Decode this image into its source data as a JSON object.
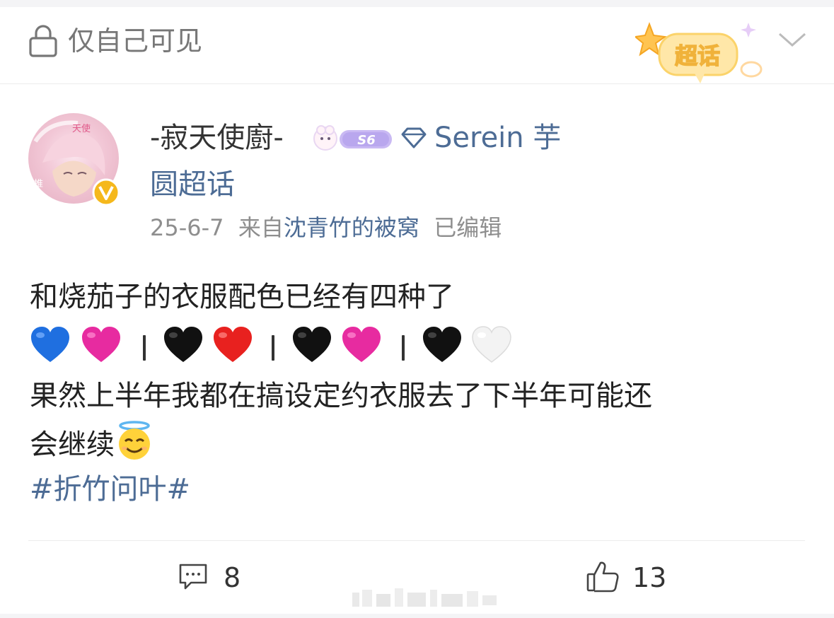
{
  "header": {
    "visibility_label": "仅自己可见",
    "supertopic_badge_label": "超话"
  },
  "post": {
    "author": {
      "username": "-寂天使廚-",
      "level_badge": "S6",
      "fan_title_part1": "Serein 芋",
      "fan_title_part2": "圆超话",
      "avatar_text": [
        "天使",
        "推"
      ]
    },
    "meta": {
      "date": "25-6-7",
      "source_prefix": "来自",
      "source_name": "沈青竹的被窝",
      "edited": "已编辑"
    },
    "content": {
      "line1": "和烧茄子的衣服配色已经有四种了",
      "hearts": [
        "blue-heart",
        "pink-heart",
        "separator",
        "black-heart",
        "red-heart",
        "separator",
        "black-heart",
        "pink-heart",
        "separator",
        "black-heart",
        "white-heart"
      ],
      "line3": "果然上半年我都在搞设定约衣服去了下半年可能还",
      "line4": "会继续",
      "hashtag": "#折竹问叶#"
    },
    "actions": {
      "comments": "8",
      "likes": "13"
    }
  },
  "colors": {
    "link": "#4d6c95",
    "muted": "#8e8e8e",
    "verified": "#f5b81c",
    "badge_purple": "#b9a7ee"
  }
}
